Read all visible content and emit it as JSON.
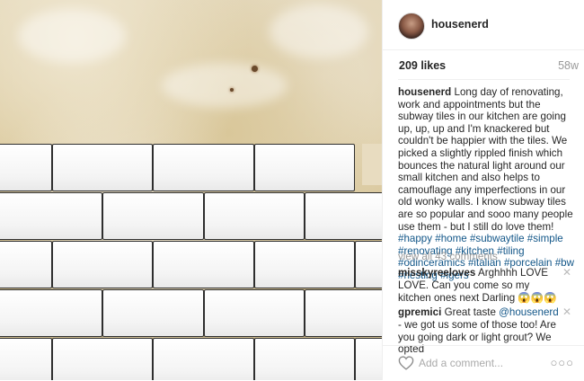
{
  "post": {
    "username": "housenerd",
    "likes": "209 likes",
    "age": "58w",
    "caption": {
      "author": "housenerd",
      "text": "Long day of renovating, work and appointments but the subway tiles in our kitchen are going up, up, up and I'm knackered but couldn't be happier with the tiles. We picked a slightly rippled finish which bounces the natural light around our small kitchen and also helps to camouflage any imperfections in our old wonky walls. I know subway tiles are so popular and sooo many people use them - but I still do love them! ",
      "hashtags": [
        "#happy",
        "#home",
        "#subwaytile",
        "#simple",
        "#renovating",
        "#kitchen",
        "#tiling",
        "#odinceramics",
        "#italian",
        "#porcelain",
        "#bw",
        "#nesting",
        "#igers"
      ]
    },
    "view_all_comments": "view all 43 comments",
    "comments": [
      {
        "user": "misskyreeloves",
        "text": "Arghhhh LOVE LOVE. Can you come so my kitchen ones next Darling 😱😱😱",
        "delete_icon": "close-icon"
      },
      {
        "user": "gpremici",
        "text_before": "Great taste ",
        "mention": "@housenerd",
        "text_after": " - we got us some of those too! Are you going dark or light grout? We opted",
        "delete_icon": "close-icon"
      }
    ],
    "add_comment_placeholder": "Add a comment...",
    "icons": {
      "like": "heart-icon",
      "more": "more-options-icon"
    },
    "colors": {
      "hashtag": "#125688",
      "muted": "#999999",
      "text": "#262626"
    }
  }
}
